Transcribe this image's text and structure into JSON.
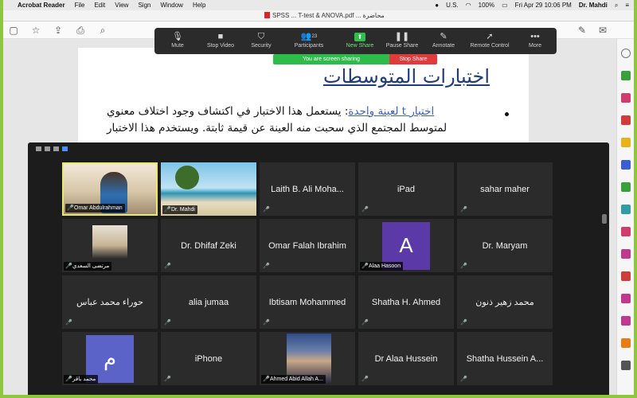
{
  "menubar": {
    "app_name": "Acrobat Reader",
    "menus": [
      "File",
      "Edit",
      "View",
      "Sign",
      "Window",
      "Help"
    ],
    "input_source": "U.S.",
    "battery": "100%",
    "datetime": "Fri Apr 29  10:06 PM",
    "user": "Dr. Mahdi"
  },
  "window": {
    "title": "SPSS ... T-test & ANOVA.pdf ... محاضرة"
  },
  "zoom_controls": {
    "mute": "Mute",
    "stop_video": "Stop Video",
    "security": "Security",
    "participants": "Participants",
    "participants_count": "23",
    "new_share": "New Share",
    "pause_share": "Pause Share",
    "annotate": "Annotate",
    "remote_control": "Remote Control",
    "more": "More"
  },
  "share_banner": {
    "status": "You are screen sharing",
    "stop": "Stop Share"
  },
  "document": {
    "title": "اختبارات المتوسطات",
    "link_text": "اختبار t لعينة واحدة",
    "line1_rest": ": يستعمل هذا الاختبار في اكتشاف وجود اختلاف معنوي",
    "line2": "لمتوسط المجتمع الذي سحبت منه العينة عن قيمة ثابتة. ويستخدم هذا الاختبار"
  },
  "gallery": {
    "tiles": [
      {
        "name": "Omar Abdulrahman",
        "style": "photo-omar",
        "active": true
      },
      {
        "name": "Dr. Mahdi",
        "style": "photo-beach"
      },
      {
        "center": "Laith B. Ali Moha..."
      },
      {
        "center": "iPad"
      },
      {
        "center": "sahar maher"
      },
      {
        "name": "مرتضى السعدي",
        "style": "photo-murtada"
      },
      {
        "center": "Dr. Dhifaf Zeki"
      },
      {
        "center": "Omar Falah Ibrahim"
      },
      {
        "name": "Alaa Hasoon",
        "avatar": "A",
        "avatar_color": "#5b3aa8"
      },
      {
        "center": "Dr. Maryam"
      },
      {
        "center": "حوراء محمد عباس"
      },
      {
        "center": "alia jumaa"
      },
      {
        "center": "Ibtisam Mohammed"
      },
      {
        "center": "Shatha H. Ahmed"
      },
      {
        "center": "محمد زهير ذنون"
      },
      {
        "name": "محمد باقر",
        "avatar": "م",
        "avatar_color": "#5b63c8"
      },
      {
        "center": "iPhone"
      },
      {
        "name": "Ahmed Abid Allah A...",
        "style": "photo-ahmed"
      },
      {
        "center": "Dr Alaa Hussein"
      },
      {
        "center": "Shatha Hussein A..."
      }
    ]
  },
  "colors": {
    "share_green": "#2dbb4a",
    "stop_red": "#e03a3a",
    "active_speaker": "#e8e86a",
    "doc_title": "#1f3d7a"
  }
}
